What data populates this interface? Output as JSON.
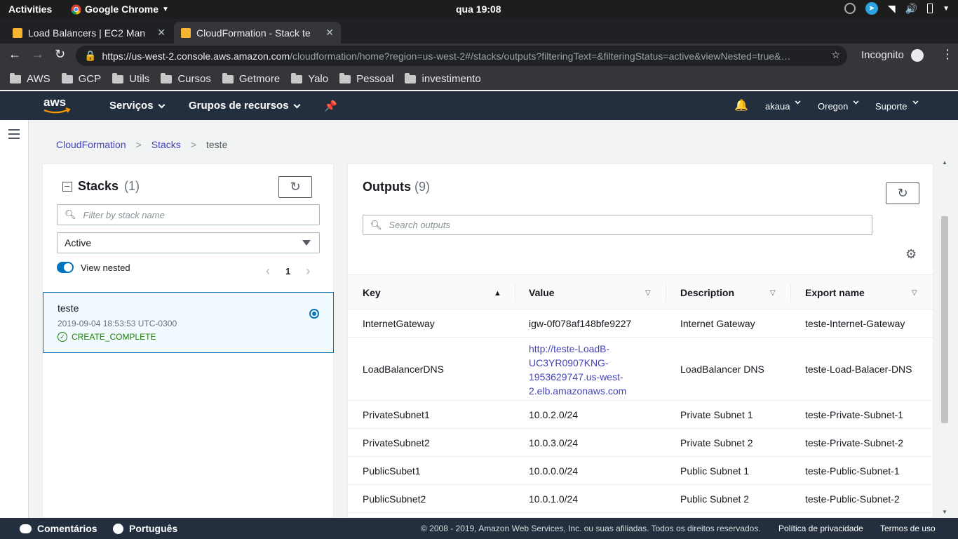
{
  "os": {
    "activities": "Activities",
    "app": "Google Chrome",
    "clock": "qua 19:08"
  },
  "tabs": [
    {
      "title": "Load Balancers | EC2 Man"
    },
    {
      "title": "CloudFormation - Stack te"
    }
  ],
  "toolbar": {
    "url_host": "https://us-west-2.console.aws.amazon.com",
    "url_path": "/cloudformation/home?region=us-west-2#/stacks/outputs?filteringText=&filteringStatus=active&viewNested=true&…",
    "incognito": "Incognito"
  },
  "bookmarks": [
    "AWS",
    "GCP",
    "Utils",
    "Cursos",
    "Getmore",
    "Yalo",
    "Pessoal",
    "investimento"
  ],
  "aws_nav": {
    "services": "Serviços",
    "resource_groups": "Grupos de recursos",
    "user": "akaua",
    "region": "Oregon",
    "support": "Suporte"
  },
  "breadcrumb": {
    "root": "CloudFormation",
    "stacks": "Stacks",
    "current": "teste"
  },
  "stacks_panel": {
    "title": "Stacks",
    "count": "(1)",
    "filter_placeholder": "Filter by stack name",
    "status_filter": "Active",
    "view_nested": "View nested",
    "page": "1",
    "stack": {
      "name": "teste",
      "date": "2019-09-04 18:53:53 UTC-0300",
      "status": "CREATE_COMPLETE"
    }
  },
  "outputs_panel": {
    "title": "Outputs",
    "count": "(9)",
    "search_placeholder": "Search outputs",
    "columns": [
      "Key",
      "Value",
      "Description",
      "Export name"
    ],
    "rows": [
      {
        "key": "InternetGateway",
        "value": "igw-0f078af148bfe9227",
        "description": "Internet Gateway",
        "export": "teste-Internet-Gateway"
      },
      {
        "key": "LoadBalancerDNS",
        "value": "http://teste-LoadB-UC3YR0907KNG-1953629747.us-west-2.elb.amazonaws.com",
        "value_lines": [
          "http://teste-LoadB-",
          "UC3YR0907KNG-",
          "1953629747.us-west-",
          "2.elb.amazonaws.com"
        ],
        "description": "LoadBalancer DNS",
        "export": "teste-Load-Balacer-DNS"
      },
      {
        "key": "PrivateSubnet1",
        "value": "10.0.2.0/24",
        "description": "Private Subnet 1",
        "export": "teste-Private-Subnet-1"
      },
      {
        "key": "PrivateSubnet2",
        "value": "10.0.3.0/24",
        "description": "Private Subnet 2",
        "export": "teste-Private-Subnet-2"
      },
      {
        "key": "PublicSubet1",
        "value": "10.0.0.0/24",
        "description": "Public Subnet 1",
        "export": "teste-Public-Subnet-1"
      },
      {
        "key": "PublicSubnet2",
        "value": "10.0.1.0/24",
        "description": "Public Subnet 2",
        "export": "teste-Public-Subnet-2"
      }
    ]
  },
  "footer": {
    "feedback": "Comentários",
    "language": "Português",
    "copyright": "© 2008 - 2019, Amazon Web Services, Inc. ou suas afiliadas. Todos os direitos reservados.",
    "privacy": "Política de privacidade",
    "terms": "Termos de uso"
  }
}
